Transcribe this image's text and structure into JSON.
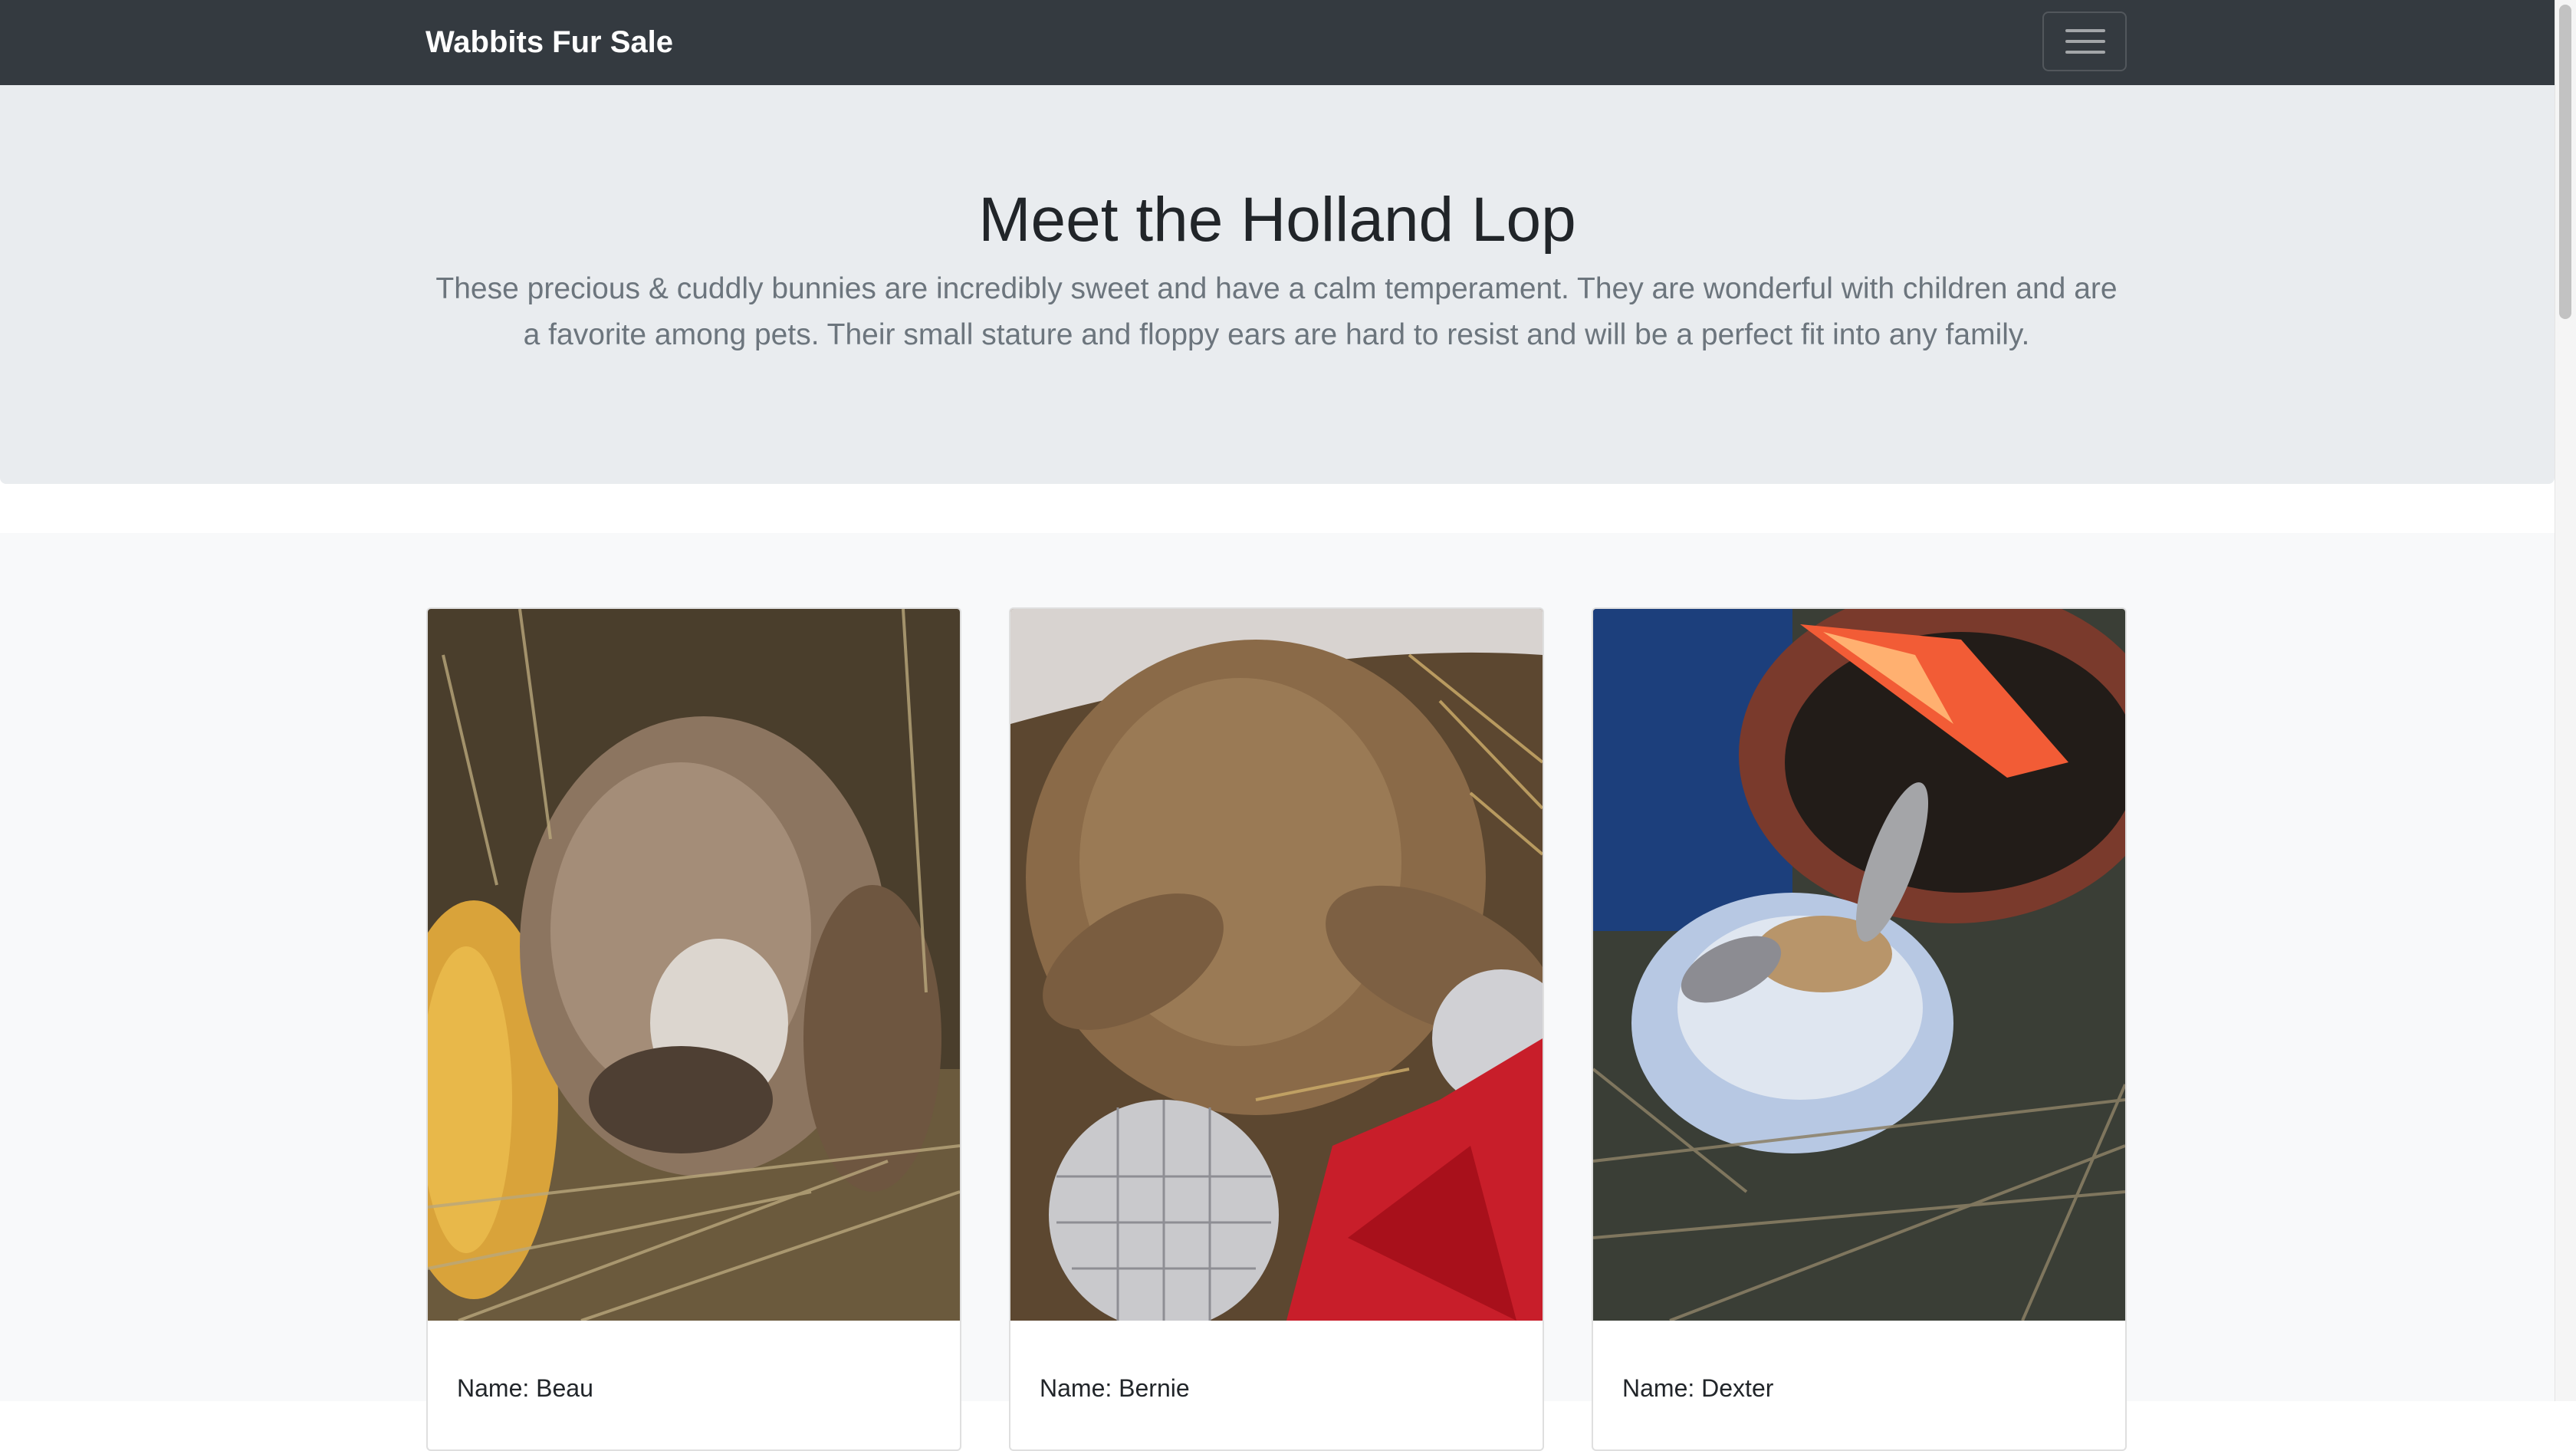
{
  "navbar": {
    "brand": "Wabbits Fur Sale",
    "menu_icon": "hamburger-menu-icon"
  },
  "hero": {
    "title": "Meet the Holland Lop",
    "description": "These precious & cuddly bunnies are incredibly sweet and have a calm temperament. They are wonderful with children and are a favorite among pets. Their small stature and floppy ears are hard to resist and will be a perfect fit into any family."
  },
  "cards": [
    {
      "name_label": "Name: Beau",
      "image": "rabbit-photo-beau"
    },
    {
      "name_label": "Name: Bernie",
      "image": "rabbit-photo-bernie"
    },
    {
      "name_label": "Name: Dexter",
      "image": "rabbit-photo-dexter"
    }
  ],
  "colors": {
    "navbar_bg": "#343a40",
    "jumbotron_bg": "#e9ecef",
    "album_bg": "#f8f9fa",
    "lead_text": "#6c757d"
  }
}
